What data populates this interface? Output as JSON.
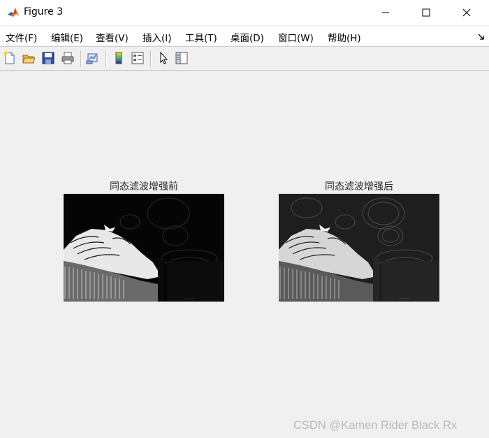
{
  "window": {
    "title": "Figure 3"
  },
  "menu": [
    {
      "label": "文件(F)"
    },
    {
      "label": "编辑(E)"
    },
    {
      "label": "查看(V)"
    },
    {
      "label": "插入(I)"
    },
    {
      "label": "工具(T)"
    },
    {
      "label": "桌面(D)"
    },
    {
      "label": "窗口(W)"
    },
    {
      "label": "帮助(H)"
    }
  ],
  "toolbar": {
    "icons": [
      "new-figure-icon",
      "open-file-icon",
      "save-icon",
      "print-icon",
      "link-plot-icon",
      "insert-colorbar-icon",
      "insert-legend-icon",
      "edit-plot-arrow-icon",
      "property-inspector-icon"
    ]
  },
  "axes": [
    {
      "title": "同态滤波增强前",
      "image": "grayscale temple roof photo, before enhancement"
    },
    {
      "title": "同态滤波增强后",
      "image": "grayscale temple roof photo, after enhancement"
    }
  ],
  "watermark": "CSDN @Kamen Rider Black Rx",
  "colors": {
    "titlebar": "#ffffff",
    "figure_bg": "#f0f0f0",
    "matlab_orange": "#e8751a",
    "matlab_blue": "#1a6fb0"
  }
}
